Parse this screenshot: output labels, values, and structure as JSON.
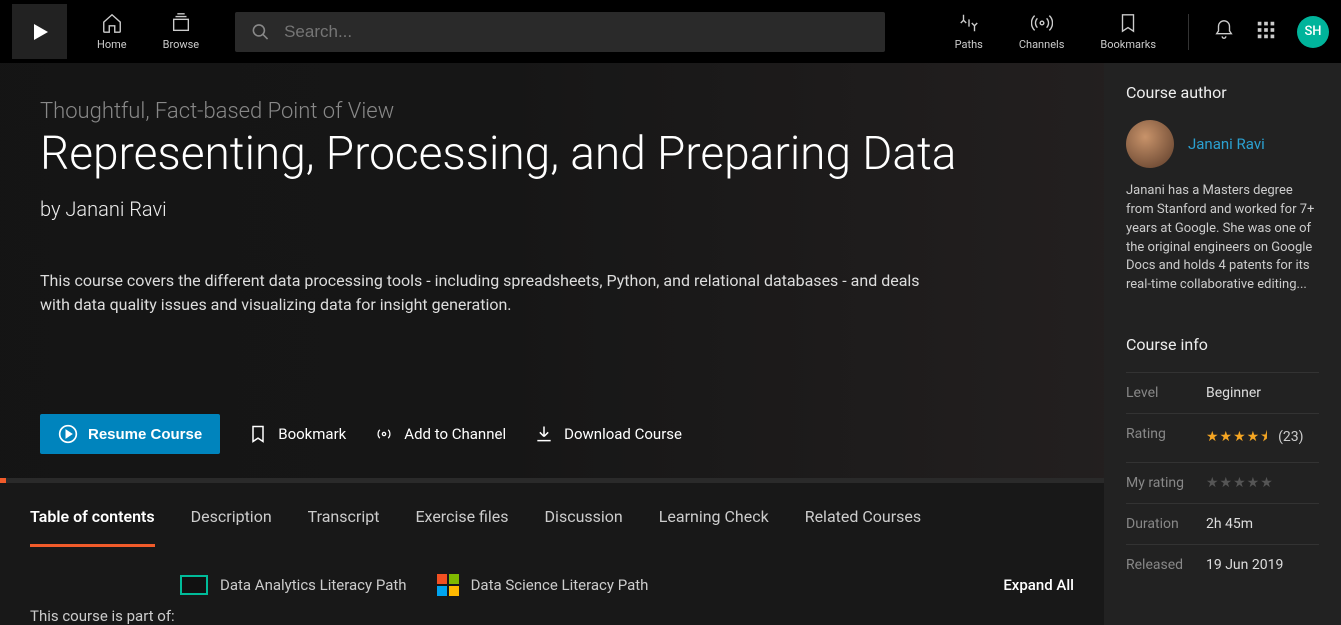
{
  "header": {
    "home": "Home",
    "browse": "Browse",
    "paths": "Paths",
    "channels": "Channels",
    "bookmarks": "Bookmarks",
    "search_placeholder": "Search...",
    "avatar_initials": "SH"
  },
  "hero": {
    "breadcrumb": "Thoughtful, Fact-based Point of View",
    "title": "Representing, Processing, and Preparing Data",
    "byline": "by Janani Ravi",
    "description": "This course covers the different data processing tools - including spreadsheets, Python, and relational databases - and deals with data quality issues and visualizing data for insight generation.",
    "actions": {
      "resume": "Resume Course",
      "bookmark": "Bookmark",
      "add_channel": "Add to Channel",
      "download": "Download Course"
    }
  },
  "tabs": [
    "Table of contents",
    "Description",
    "Transcript",
    "Exercise files",
    "Discussion",
    "Learning Check",
    "Related Courses"
  ],
  "paths_of": {
    "label": "This course is part of:",
    "items": [
      "Data Analytics Literacy Path",
      "Data Science Literacy Path"
    ],
    "expand": "Expand All"
  },
  "author": {
    "section": "Course author",
    "name": "Janani Ravi",
    "bio": "Janani has a Masters degree from Stanford and worked for 7+ years at Google. She was one of the original engineers on Google Docs and holds 4 patents for its real-time collaborative editing..."
  },
  "info": {
    "section": "Course info",
    "level_label": "Level",
    "level": "Beginner",
    "rating_label": "Rating",
    "rating_stars": "★★★★⯨",
    "rating_count": "(23)",
    "myrating_label": "My rating",
    "myrating_stars": "★★★★★",
    "duration_label": "Duration",
    "duration": "2h 45m",
    "released_label": "Released",
    "released": "19 Jun 2019"
  }
}
